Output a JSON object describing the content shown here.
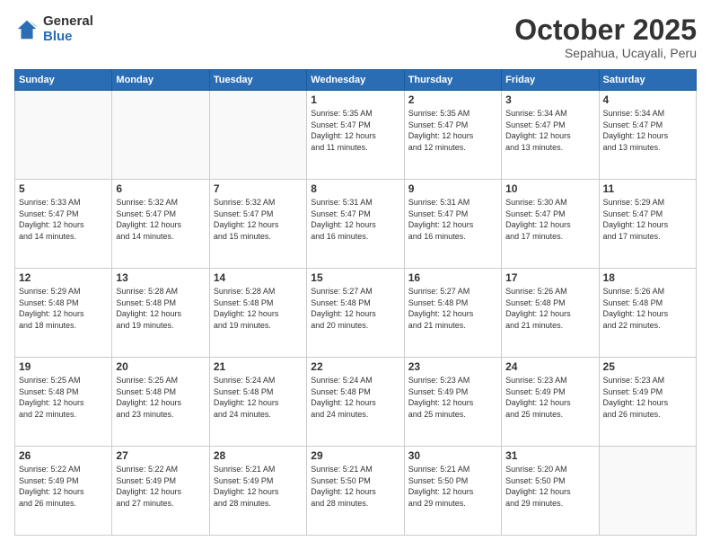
{
  "logo": {
    "general": "General",
    "blue": "Blue"
  },
  "header": {
    "month": "October 2025",
    "location": "Sepahua, Ucayali, Peru"
  },
  "days_of_week": [
    "Sunday",
    "Monday",
    "Tuesday",
    "Wednesday",
    "Thursday",
    "Friday",
    "Saturday"
  ],
  "weeks": [
    [
      {
        "day": "",
        "info": ""
      },
      {
        "day": "",
        "info": ""
      },
      {
        "day": "",
        "info": ""
      },
      {
        "day": "1",
        "info": "Sunrise: 5:35 AM\nSunset: 5:47 PM\nDaylight: 12 hours\nand 11 minutes."
      },
      {
        "day": "2",
        "info": "Sunrise: 5:35 AM\nSunset: 5:47 PM\nDaylight: 12 hours\nand 12 minutes."
      },
      {
        "day": "3",
        "info": "Sunrise: 5:34 AM\nSunset: 5:47 PM\nDaylight: 12 hours\nand 13 minutes."
      },
      {
        "day": "4",
        "info": "Sunrise: 5:34 AM\nSunset: 5:47 PM\nDaylight: 12 hours\nand 13 minutes."
      }
    ],
    [
      {
        "day": "5",
        "info": "Sunrise: 5:33 AM\nSunset: 5:47 PM\nDaylight: 12 hours\nand 14 minutes."
      },
      {
        "day": "6",
        "info": "Sunrise: 5:32 AM\nSunset: 5:47 PM\nDaylight: 12 hours\nand 14 minutes."
      },
      {
        "day": "7",
        "info": "Sunrise: 5:32 AM\nSunset: 5:47 PM\nDaylight: 12 hours\nand 15 minutes."
      },
      {
        "day": "8",
        "info": "Sunrise: 5:31 AM\nSunset: 5:47 PM\nDaylight: 12 hours\nand 16 minutes."
      },
      {
        "day": "9",
        "info": "Sunrise: 5:31 AM\nSunset: 5:47 PM\nDaylight: 12 hours\nand 16 minutes."
      },
      {
        "day": "10",
        "info": "Sunrise: 5:30 AM\nSunset: 5:47 PM\nDaylight: 12 hours\nand 17 minutes."
      },
      {
        "day": "11",
        "info": "Sunrise: 5:29 AM\nSunset: 5:47 PM\nDaylight: 12 hours\nand 17 minutes."
      }
    ],
    [
      {
        "day": "12",
        "info": "Sunrise: 5:29 AM\nSunset: 5:48 PM\nDaylight: 12 hours\nand 18 minutes."
      },
      {
        "day": "13",
        "info": "Sunrise: 5:28 AM\nSunset: 5:48 PM\nDaylight: 12 hours\nand 19 minutes."
      },
      {
        "day": "14",
        "info": "Sunrise: 5:28 AM\nSunset: 5:48 PM\nDaylight: 12 hours\nand 19 minutes."
      },
      {
        "day": "15",
        "info": "Sunrise: 5:27 AM\nSunset: 5:48 PM\nDaylight: 12 hours\nand 20 minutes."
      },
      {
        "day": "16",
        "info": "Sunrise: 5:27 AM\nSunset: 5:48 PM\nDaylight: 12 hours\nand 21 minutes."
      },
      {
        "day": "17",
        "info": "Sunrise: 5:26 AM\nSunset: 5:48 PM\nDaylight: 12 hours\nand 21 minutes."
      },
      {
        "day": "18",
        "info": "Sunrise: 5:26 AM\nSunset: 5:48 PM\nDaylight: 12 hours\nand 22 minutes."
      }
    ],
    [
      {
        "day": "19",
        "info": "Sunrise: 5:25 AM\nSunset: 5:48 PM\nDaylight: 12 hours\nand 22 minutes."
      },
      {
        "day": "20",
        "info": "Sunrise: 5:25 AM\nSunset: 5:48 PM\nDaylight: 12 hours\nand 23 minutes."
      },
      {
        "day": "21",
        "info": "Sunrise: 5:24 AM\nSunset: 5:48 PM\nDaylight: 12 hours\nand 24 minutes."
      },
      {
        "day": "22",
        "info": "Sunrise: 5:24 AM\nSunset: 5:48 PM\nDaylight: 12 hours\nand 24 minutes."
      },
      {
        "day": "23",
        "info": "Sunrise: 5:23 AM\nSunset: 5:49 PM\nDaylight: 12 hours\nand 25 minutes."
      },
      {
        "day": "24",
        "info": "Sunrise: 5:23 AM\nSunset: 5:49 PM\nDaylight: 12 hours\nand 25 minutes."
      },
      {
        "day": "25",
        "info": "Sunrise: 5:23 AM\nSunset: 5:49 PM\nDaylight: 12 hours\nand 26 minutes."
      }
    ],
    [
      {
        "day": "26",
        "info": "Sunrise: 5:22 AM\nSunset: 5:49 PM\nDaylight: 12 hours\nand 26 minutes."
      },
      {
        "day": "27",
        "info": "Sunrise: 5:22 AM\nSunset: 5:49 PM\nDaylight: 12 hours\nand 27 minutes."
      },
      {
        "day": "28",
        "info": "Sunrise: 5:21 AM\nSunset: 5:49 PM\nDaylight: 12 hours\nand 28 minutes."
      },
      {
        "day": "29",
        "info": "Sunrise: 5:21 AM\nSunset: 5:50 PM\nDaylight: 12 hours\nand 28 minutes."
      },
      {
        "day": "30",
        "info": "Sunrise: 5:21 AM\nSunset: 5:50 PM\nDaylight: 12 hours\nand 29 minutes."
      },
      {
        "day": "31",
        "info": "Sunrise: 5:20 AM\nSunset: 5:50 PM\nDaylight: 12 hours\nand 29 minutes."
      },
      {
        "day": "",
        "info": ""
      }
    ]
  ]
}
